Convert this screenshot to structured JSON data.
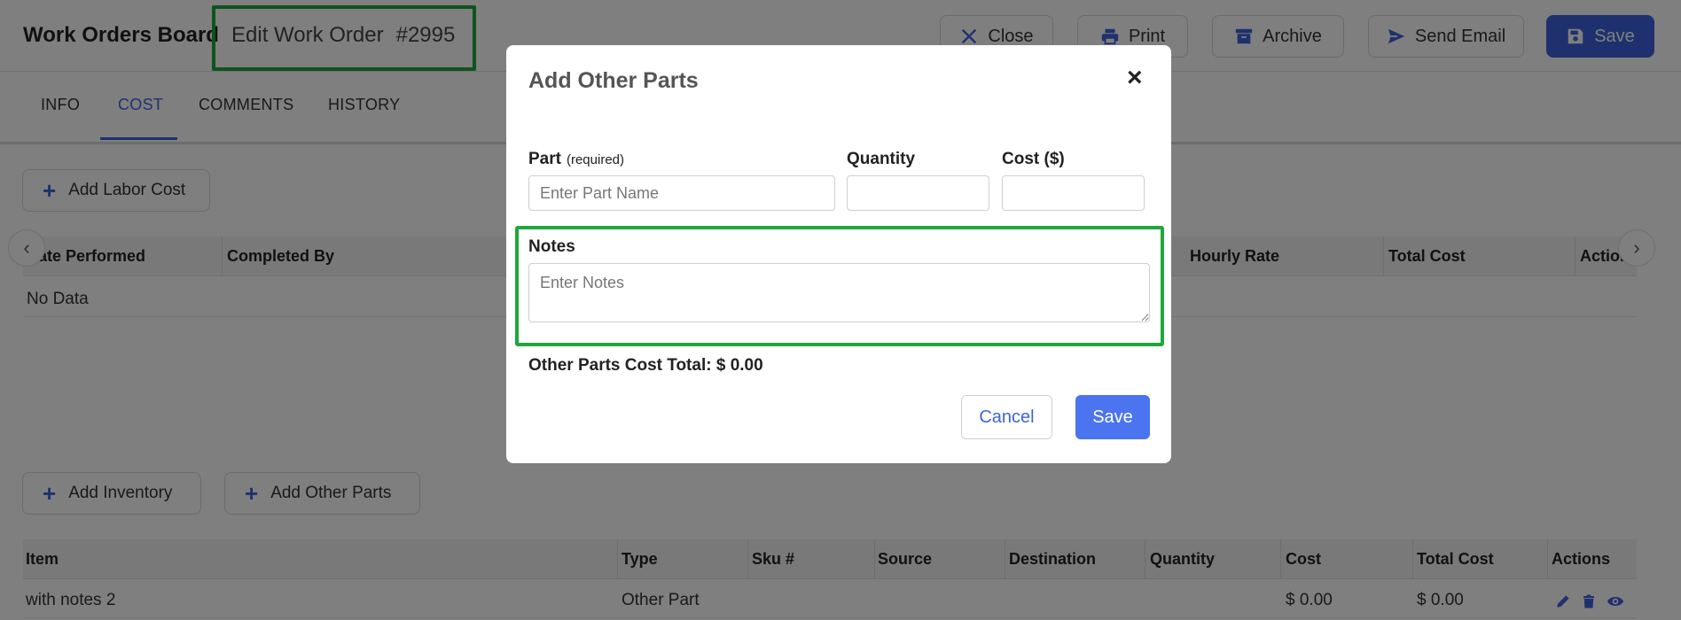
{
  "header": {
    "board_title": "Work Orders Board",
    "edit_title": "Edit Work Order",
    "order_number": "#2995",
    "buttons": {
      "close": "Close",
      "print": "Print",
      "archive": "Archive",
      "send_email": "Send Email",
      "save": "Save"
    }
  },
  "tabs": [
    {
      "label": "INFO"
    },
    {
      "label": "COST",
      "active": true
    },
    {
      "label": "COMMENTS"
    },
    {
      "label": "HISTORY"
    }
  ],
  "labor": {
    "add_button": "Add Labor Cost",
    "columns": [
      "Date Performed",
      "Completed By",
      "Hourly Rate",
      "Total Cost",
      "Actions"
    ],
    "empty_text": "No Data"
  },
  "parts": {
    "add_inventory": "Add Inventory",
    "add_other_parts": "Add Other Parts",
    "columns": [
      "Item",
      "Type",
      "Sku #",
      "Source",
      "Destination",
      "Quantity",
      "Cost",
      "Total Cost",
      "Actions"
    ],
    "rows": [
      {
        "item": "with notes 2",
        "type": "Other Part",
        "sku": "",
        "source": "",
        "destination": "",
        "quantity": "",
        "cost": "$ 0.00",
        "total_cost": "$ 0.00"
      }
    ]
  },
  "modal": {
    "title": "Add Other Parts",
    "close_glyph": "×",
    "part_label": "Part",
    "part_required": "(required)",
    "part_placeholder": "Enter Part Name",
    "quantity_label": "Quantity",
    "quantity_value": "",
    "cost_label": "Cost ($)",
    "cost_value": "",
    "notes_label": "Notes",
    "notes_placeholder": "Enter Notes",
    "total_label": "Other Parts Cost Total:",
    "total_value": "$ 0.00",
    "cancel": "Cancel",
    "save": "Save"
  },
  "colors": {
    "primary": "#3d63dd",
    "highlight": "#1fa73b",
    "modal_save": "#4a74f0"
  },
  "icons": [
    "close-icon",
    "print-icon",
    "archive-icon",
    "send-icon",
    "save-icon",
    "plus-icon",
    "chevron-left-icon",
    "chevron-right-icon",
    "pencil-icon",
    "trash-icon",
    "eye-icon"
  ]
}
